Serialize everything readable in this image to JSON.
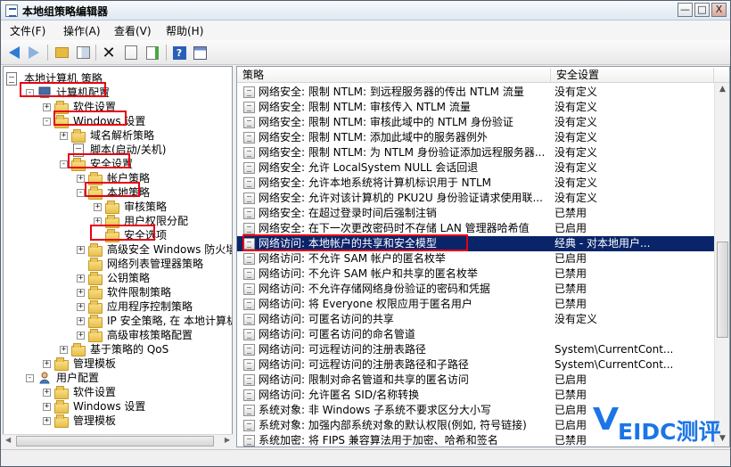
{
  "window": {
    "title": "本地组策略编辑器",
    "controls": {
      "minimize": "—",
      "maximize": "□",
      "close": "X"
    }
  },
  "menu": [
    {
      "label": "文件(F)"
    },
    {
      "label": "操作(A)"
    },
    {
      "label": "查看(V)"
    },
    {
      "label": "帮助(H)"
    }
  ],
  "toolbar": {
    "buttons": [
      {
        "icon": "back-arrow-icon"
      },
      {
        "icon": "forward-arrow-icon"
      },
      {
        "icon": "up-folder-icon"
      },
      {
        "icon": "show-hide-tree-icon"
      },
      {
        "icon": "delete-x-icon"
      },
      {
        "icon": "properties-icon"
      },
      {
        "icon": "export-list-icon"
      },
      {
        "icon": "help-question-icon"
      },
      {
        "icon": "console-window-icon"
      }
    ]
  },
  "tree": [
    {
      "label": "本地计算机 策略",
      "level": 0,
      "expander": "",
      "icon": "policy-root"
    },
    {
      "label": "计算机配置",
      "level": 1,
      "expander": "-",
      "icon": "computer"
    },
    {
      "label": "软件设置",
      "level": 2,
      "expander": "+",
      "icon": "folder"
    },
    {
      "label": "Windows 设置",
      "level": 2,
      "expander": "-",
      "icon": "folder"
    },
    {
      "label": "域名解析策略",
      "level": 3,
      "expander": "+",
      "icon": "folder"
    },
    {
      "label": "脚本(启动/关机)",
      "level": 3,
      "expander": "",
      "icon": "sheet"
    },
    {
      "label": "安全设置",
      "level": 3,
      "expander": "-",
      "icon": "folder"
    },
    {
      "label": "帐户策略",
      "level": 4,
      "expander": "+",
      "icon": "folder"
    },
    {
      "label": "本地策略",
      "level": 4,
      "expander": "-",
      "icon": "folder"
    },
    {
      "label": "审核策略",
      "level": 5,
      "expander": "+",
      "icon": "folder"
    },
    {
      "label": "用户权限分配",
      "level": 5,
      "expander": "+",
      "icon": "folder"
    },
    {
      "label": "安全选项",
      "level": 5,
      "expander": "",
      "icon": "folder"
    },
    {
      "label": "高级安全 Windows 防火墙",
      "level": 4,
      "expander": "+",
      "icon": "folder"
    },
    {
      "label": "网络列表管理器策略",
      "level": 4,
      "expander": "",
      "icon": "folder"
    },
    {
      "label": "公钥策略",
      "level": 4,
      "expander": "+",
      "icon": "folder"
    },
    {
      "label": "软件限制策略",
      "level": 4,
      "expander": "+",
      "icon": "folder"
    },
    {
      "label": "应用程序控制策略",
      "level": 4,
      "expander": "+",
      "icon": "folder"
    },
    {
      "label": "IP 安全策略, 在 本地计算机",
      "level": 4,
      "expander": "+",
      "icon": "folder"
    },
    {
      "label": "高级审核策略配置",
      "level": 4,
      "expander": "+",
      "icon": "folder"
    },
    {
      "label": "基于策略的 QoS",
      "level": 3,
      "expander": "+",
      "icon": "folder"
    },
    {
      "label": "管理模板",
      "level": 2,
      "expander": "+",
      "icon": "folder"
    },
    {
      "label": "用户配置",
      "level": 1,
      "expander": "-",
      "icon": "user"
    },
    {
      "label": "软件设置",
      "level": 2,
      "expander": "+",
      "icon": "folder"
    },
    {
      "label": "Windows 设置",
      "level": 2,
      "expander": "+",
      "icon": "folder"
    },
    {
      "label": "管理模板",
      "level": 2,
      "expander": "+",
      "icon": "folder"
    }
  ],
  "list": {
    "columns": [
      "策略",
      "安全设置"
    ],
    "rows": [
      {
        "policy": "网络安全: 限制 NTLM: 到远程服务器的传出 NTLM 流量",
        "setting": "没有定义"
      },
      {
        "policy": "网络安全: 限制 NTLM: 审核传入 NTLM 流量",
        "setting": "没有定义"
      },
      {
        "policy": "网络安全: 限制 NTLM: 审核此域中的 NTLM 身份验证",
        "setting": "没有定义"
      },
      {
        "policy": "网络安全: 限制 NTLM: 添加此域中的服务器例外",
        "setting": "没有定义"
      },
      {
        "policy": "网络安全: 限制 NTLM: 为 NTLM 身份验证添加远程服务器...",
        "setting": "没有定义"
      },
      {
        "policy": "网络安全: 允许 LocalSystem NULL 会话回退",
        "setting": "没有定义"
      },
      {
        "policy": "网络安全: 允许本地系统将计算机标识用于 NTLM",
        "setting": "没有定义"
      },
      {
        "policy": "网络安全: 允许对该计算机的 PKU2U 身份验证请求使用联...",
        "setting": "没有定义"
      },
      {
        "policy": "网络安全: 在超过登录时间后强制注销",
        "setting": "已禁用"
      },
      {
        "policy": "网络安全: 在下一次更改密码时不存储 LAN 管理器哈希值",
        "setting": "已启用"
      },
      {
        "policy": "网络访问: 本地帐户的共享和安全模型",
        "setting": "经典 - 对本地用户..."
      },
      {
        "policy": "网络访问: 不允许 SAM 帐户的匿名枚举",
        "setting": "已启用"
      },
      {
        "policy": "网络访问: 不允许 SAM 帐户和共享的匿名枚举",
        "setting": "已禁用"
      },
      {
        "policy": "网络访问: 不允许存储网络身份验证的密码和凭据",
        "setting": "已禁用"
      },
      {
        "policy": "网络访问: 将 Everyone 权限应用于匿名用户",
        "setting": "已禁用"
      },
      {
        "policy": "网络访问: 可匿名访问的共享",
        "setting": "没有定义"
      },
      {
        "policy": "网络访问: 可匿名访问的命名管道",
        "setting": ""
      },
      {
        "policy": "网络访问: 可远程访问的注册表路径",
        "setting": "System\\CurrentCont..."
      },
      {
        "policy": "网络访问: 可远程访问的注册表路径和子路径",
        "setting": "System\\CurrentCont..."
      },
      {
        "policy": "网络访问: 限制对命名管道和共享的匿名访问",
        "setting": "已启用"
      },
      {
        "policy": "网络访问: 允许匿名 SID/名称转换",
        "setting": "已禁用"
      },
      {
        "policy": "系统对象: 非 Windows 子系统不要求区分大小写",
        "setting": "已启用"
      },
      {
        "policy": "系统对象: 加强内部系统对象的默认权限(例如, 符号链接)",
        "setting": "已启用"
      },
      {
        "policy": "系统加密: 将 FIPS 兼容算法用于加密、哈希和签名",
        "setting": "已禁用"
      }
    ]
  },
  "watermark": {
    "text": "EIDC测评"
  },
  "colors": {
    "selection": "#0a246a",
    "highlight_box": "#e60012",
    "watermark": "#1b75e6"
  }
}
